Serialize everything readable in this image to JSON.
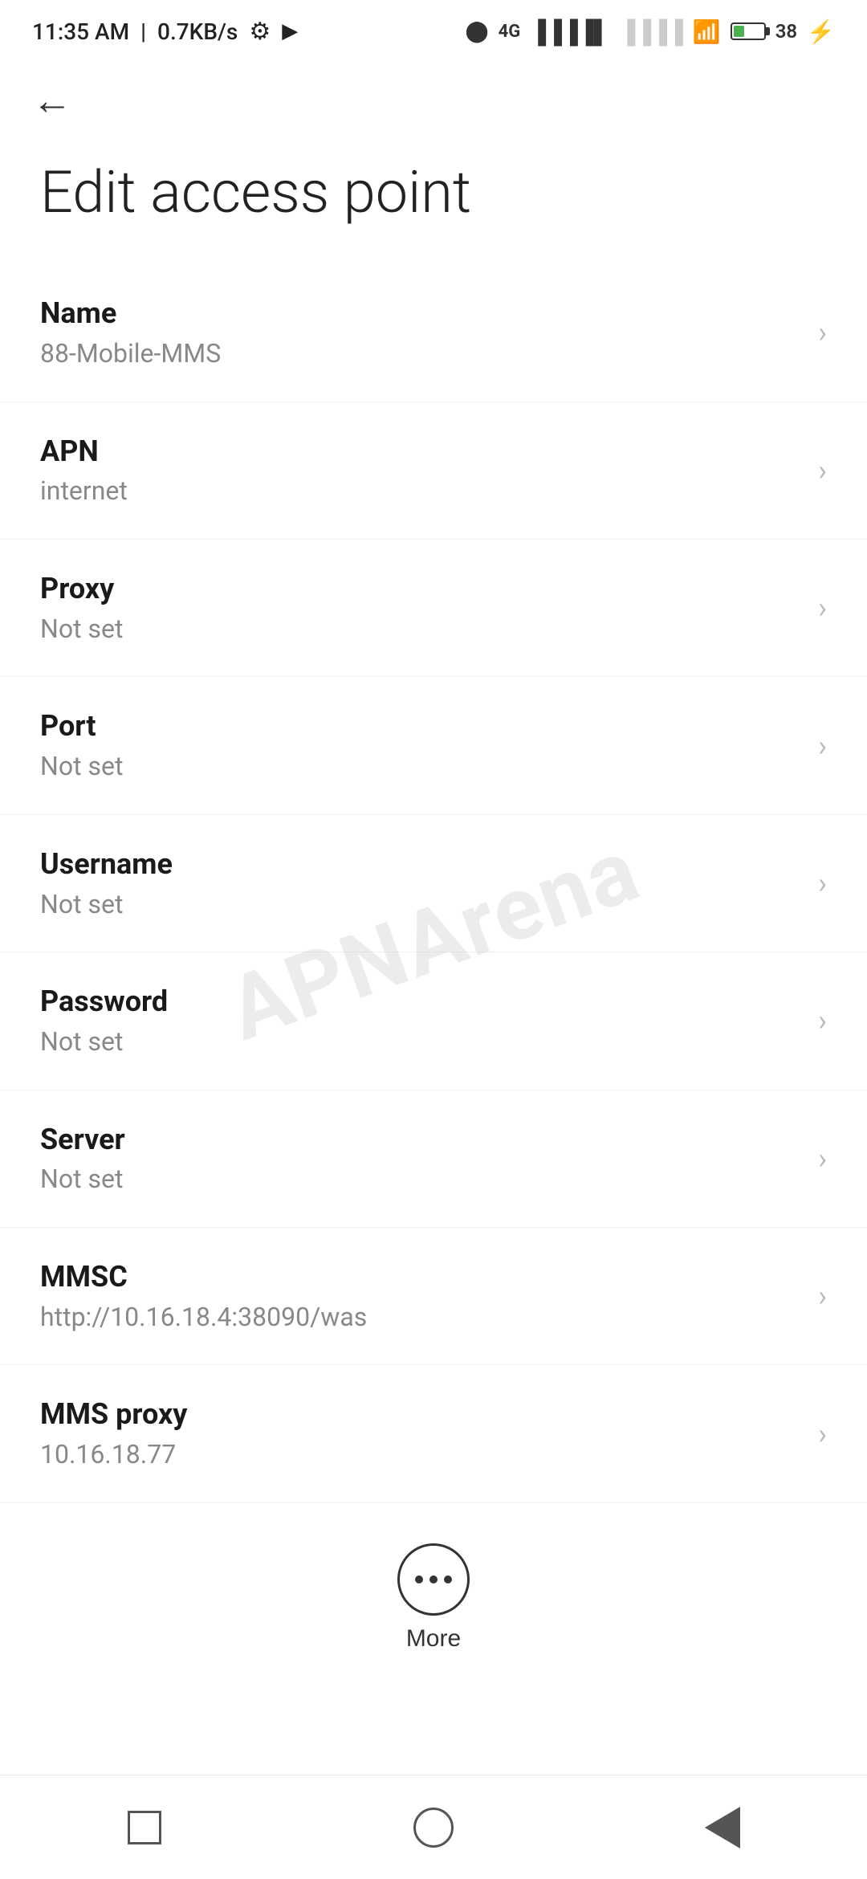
{
  "status_bar": {
    "time": "11:35 AM",
    "speed": "0.7KB/s"
  },
  "page": {
    "title": "Edit access point"
  },
  "settings": [
    {
      "label": "Name",
      "value": "88-Mobile-MMS"
    },
    {
      "label": "APN",
      "value": "internet"
    },
    {
      "label": "Proxy",
      "value": "Not set"
    },
    {
      "label": "Port",
      "value": "Not set"
    },
    {
      "label": "Username",
      "value": "Not set"
    },
    {
      "label": "Password",
      "value": "Not set"
    },
    {
      "label": "Server",
      "value": "Not set"
    },
    {
      "label": "MMSC",
      "value": "http://10.16.18.4:38090/was"
    },
    {
      "label": "MMS proxy",
      "value": "10.16.18.77"
    }
  ],
  "more_label": "More",
  "watermark": "APNArena"
}
